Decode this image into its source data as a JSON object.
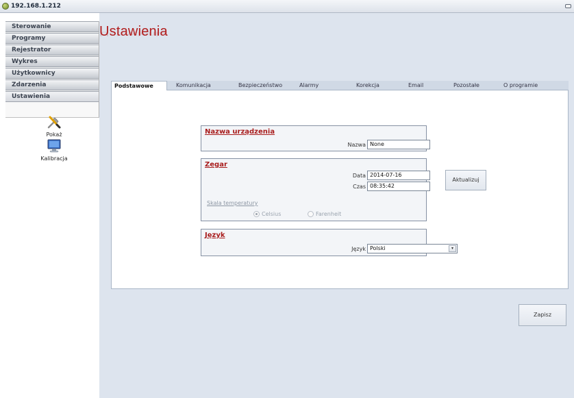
{
  "window": {
    "title": "192.168.1.212"
  },
  "sidebar": {
    "items": [
      {
        "label": "Sterowanie"
      },
      {
        "label": "Programy"
      },
      {
        "label": "Rejestrator"
      },
      {
        "label": "Wykres"
      },
      {
        "label": "Użytkownicy"
      },
      {
        "label": "Zdarzenia"
      },
      {
        "label": "Ustawienia"
      }
    ],
    "sub_items": [
      {
        "label": "Pokaż",
        "icon": "tools-icon"
      },
      {
        "label": "Kalibracja",
        "icon": "monitor-icon"
      }
    ]
  },
  "page": {
    "title": "Ustawienia"
  },
  "tabs": [
    {
      "label": "Podstawowe"
    },
    {
      "label": "Komunikacja"
    },
    {
      "label": "Bezpieczeństwo"
    },
    {
      "label": "Alarmy"
    },
    {
      "label": "Korekcja"
    },
    {
      "label": "Email"
    },
    {
      "label": "Pozostałe"
    },
    {
      "label": "O programie"
    }
  ],
  "device": {
    "legend": "Nazwa urządzenia",
    "name_label": "Nazwa",
    "name_value": "None"
  },
  "clock": {
    "legend": "Zegar",
    "date_label": "Data",
    "date_value": "2014-07-16",
    "time_label": "Czas",
    "time_value": "08:35:42",
    "update_button": "Aktualizuj",
    "temp_scale_label": "Skala temperatury",
    "celsius": "Celsius",
    "fahrenheit": "Farenheit"
  },
  "language": {
    "legend": "Język",
    "label": "Język",
    "value": "Polski"
  },
  "actions": {
    "save": "Zapisz"
  },
  "colors": {
    "accent_red": "#b11d1d",
    "content_bg": "#dde4ee"
  }
}
